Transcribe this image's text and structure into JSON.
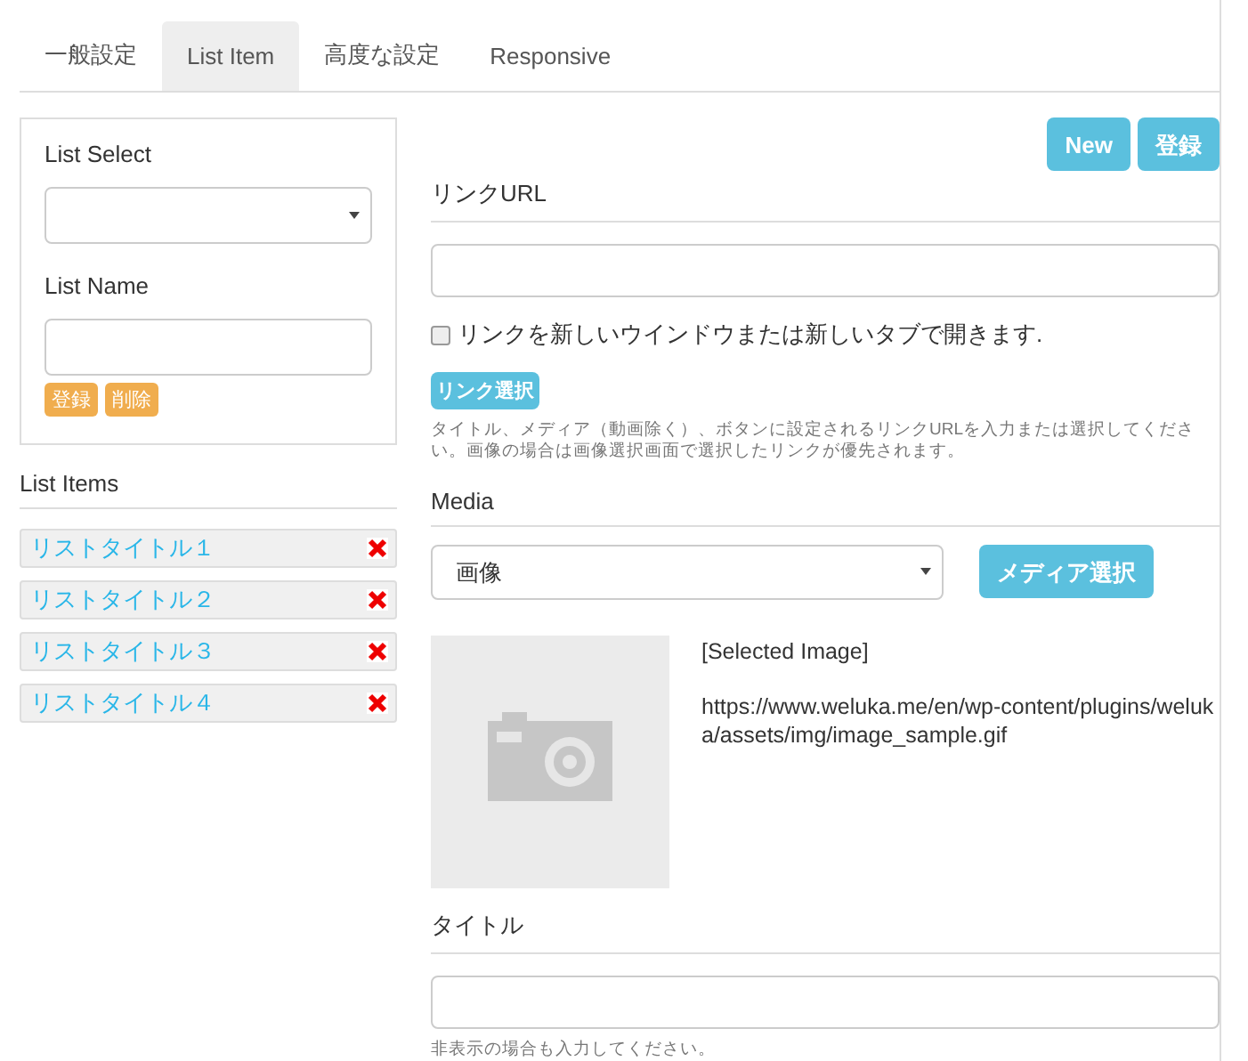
{
  "tabs": [
    {
      "label": "一般設定",
      "selected": false
    },
    {
      "label": "List Item",
      "selected": true
    },
    {
      "label": "高度な設定",
      "selected": false
    },
    {
      "label": "Responsive",
      "selected": false
    }
  ],
  "list_panel": {
    "select_label": "List Select",
    "name_label": "List Name",
    "buttons": [
      "登録",
      "削除"
    ]
  },
  "list_items": {
    "heading": "List Items",
    "items": [
      {
        "label": "リストタイトル１"
      },
      {
        "label": "リストタイトル２"
      },
      {
        "label": "リストタイトル３"
      },
      {
        "label": "リストタイトル４"
      }
    ]
  },
  "top_buttons": [
    "New",
    "登録"
  ],
  "link": {
    "heading": "リンクURL",
    "new_window": {
      "label": "リンクを新しいウインドウまたは新しいタブで開きます.",
      "checked": false
    },
    "select_button": "リンク選択",
    "help": "タイトル、メディア（動画除く）、ボタンに設定されるリンクURLを入力または選択してください。画像の場合は画像選択画面で選択したリンクが優先されます。"
  },
  "media": {
    "heading": "Media",
    "type": "画像",
    "select_button": "メディア選択",
    "selected_label": "[Selected Image]",
    "url": "https://www.weluka.me/en/wp-content/plugins/weluka/assets/img/image_sample.gif"
  },
  "title_section": {
    "heading": "タイトル",
    "help": "非表示の場合も入力してください。"
  }
}
